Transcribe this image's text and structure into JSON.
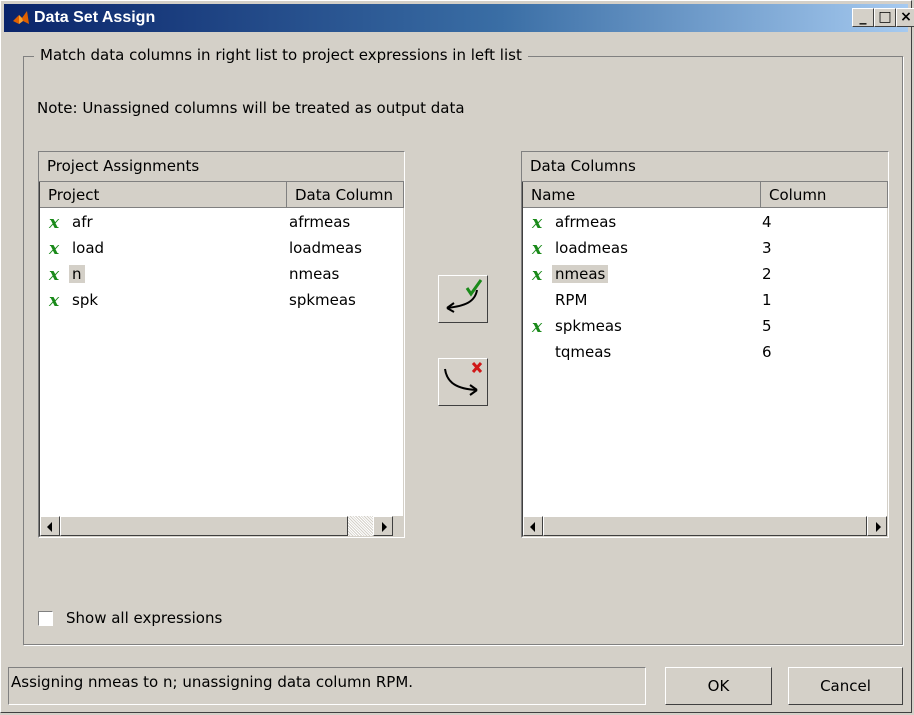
{
  "window": {
    "title": "Data Set Assign",
    "controls": {
      "minimize": "_",
      "maximize": "□",
      "close": "×"
    }
  },
  "group": {
    "legend": "Match data columns in right list to project expressions in left list",
    "note": "Note: Unassigned columns will be treated as output data"
  },
  "left_panel": {
    "title": "Project Assignments",
    "headers": [
      "Project",
      "Data Column"
    ],
    "rows": [
      {
        "mark": "x",
        "project": "afr",
        "data_column": "afrmeas"
      },
      {
        "mark": "x",
        "project": "load",
        "data_column": "loadmeas"
      },
      {
        "mark": "x",
        "project": "n",
        "data_column": "nmeas",
        "selected": true
      },
      {
        "mark": "x",
        "project": "spk",
        "data_column": "spkmeas"
      }
    ]
  },
  "right_panel": {
    "title": "Data Columns",
    "headers": [
      "Name",
      "Column"
    ],
    "rows": [
      {
        "mark": "x",
        "name": "afrmeas",
        "column": "4"
      },
      {
        "mark": "x",
        "name": "loadmeas",
        "column": "3"
      },
      {
        "mark": "x",
        "name": "nmeas",
        "column": "2",
        "selected": true
      },
      {
        "mark": "",
        "name": "RPM",
        "column": "1"
      },
      {
        "mark": "x",
        "name": "spkmeas",
        "column": "5"
      },
      {
        "mark": "",
        "name": "tqmeas",
        "column": "6"
      }
    ]
  },
  "show_all": {
    "label": "Show all expressions",
    "checked": false
  },
  "status": {
    "text": "Assigning nmeas to n; unassigning data column RPM."
  },
  "buttons": {
    "ok": "OK",
    "cancel": "Cancel"
  },
  "colors": {
    "title_bar": "#0a246a",
    "assigned_mark": "#1a8a1a",
    "unassign_mark": "#d01818"
  }
}
